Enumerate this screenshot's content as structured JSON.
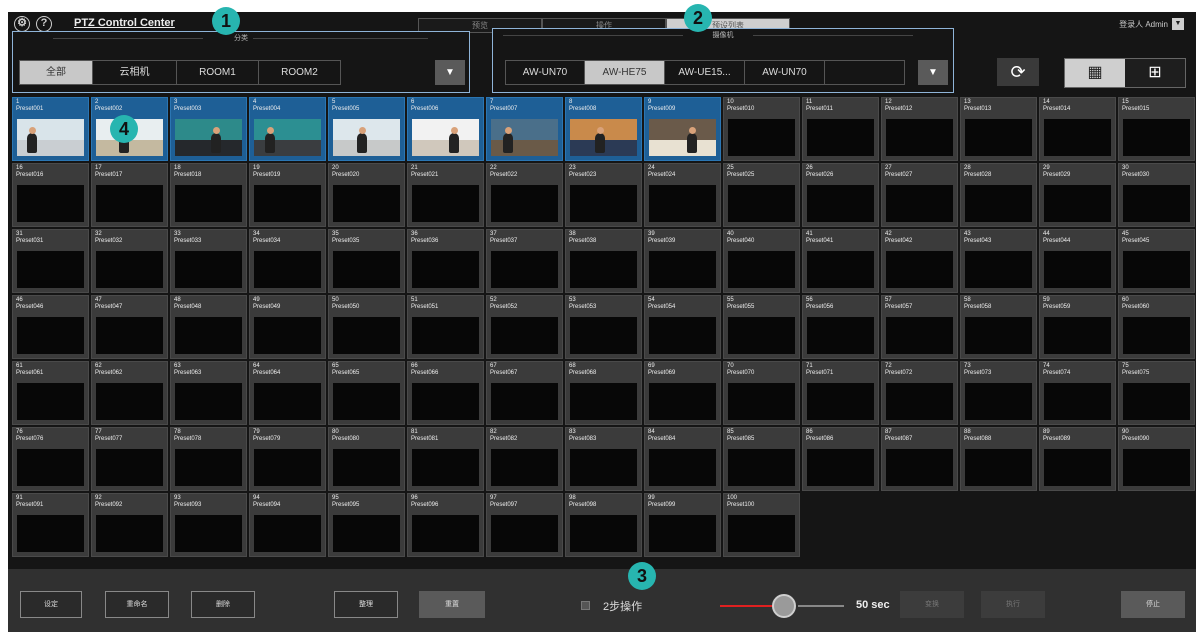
{
  "header": {
    "title": "PTZ Control Center",
    "mode_tabs": [
      "预览",
      "操作",
      "预设列表"
    ],
    "active_mode": 2,
    "login_label": "登录人 Admin"
  },
  "category_panel": {
    "label": "分类",
    "options": [
      "全部",
      "云相机",
      "ROOM1",
      "ROOM2"
    ],
    "selected": 0
  },
  "camera_panel": {
    "label": "摄像机",
    "options": [
      "AW-UN70",
      "AW-HE75",
      "AW-UE15...",
      "AW-UN70"
    ],
    "selected": 1
  },
  "view_toggle": {
    "selected": 0
  },
  "presets": [
    {
      "n": "1",
      "name": "Preset001",
      "thumb": true
    },
    {
      "n": "2",
      "name": "Preset002",
      "thumb": true
    },
    {
      "n": "3",
      "name": "Preset003",
      "thumb": true
    },
    {
      "n": "4",
      "name": "Preset004",
      "thumb": true
    },
    {
      "n": "5",
      "name": "Preset005",
      "thumb": true
    },
    {
      "n": "6",
      "name": "Preset006",
      "thumb": true
    },
    {
      "n": "7",
      "name": "Preset007",
      "thumb": true
    },
    {
      "n": "8",
      "name": "Preset008",
      "thumb": true
    },
    {
      "n": "9",
      "name": "Preset009",
      "thumb": true
    },
    {
      "n": "10",
      "name": "Preset010"
    },
    {
      "n": "11",
      "name": "Preset011"
    },
    {
      "n": "12",
      "name": "Preset012"
    },
    {
      "n": "13",
      "name": "Preset013"
    },
    {
      "n": "14",
      "name": "Preset014"
    },
    {
      "n": "15",
      "name": "Preset015"
    },
    {
      "n": "16",
      "name": "Preset016"
    },
    {
      "n": "17",
      "name": "Preset017"
    },
    {
      "n": "18",
      "name": "Preset018"
    },
    {
      "n": "19",
      "name": "Preset019"
    },
    {
      "n": "20",
      "name": "Preset020"
    },
    {
      "n": "21",
      "name": "Preset021"
    },
    {
      "n": "22",
      "name": "Preset022"
    },
    {
      "n": "23",
      "name": "Preset023"
    },
    {
      "n": "24",
      "name": "Preset024"
    },
    {
      "n": "25",
      "name": "Preset025"
    },
    {
      "n": "26",
      "name": "Preset026"
    },
    {
      "n": "27",
      "name": "Preset027"
    },
    {
      "n": "28",
      "name": "Preset028"
    },
    {
      "n": "29",
      "name": "Preset029"
    },
    {
      "n": "30",
      "name": "Preset030"
    },
    {
      "n": "31",
      "name": "Preset031"
    },
    {
      "n": "32",
      "name": "Preset032"
    },
    {
      "n": "33",
      "name": "Preset033"
    },
    {
      "n": "34",
      "name": "Preset034"
    },
    {
      "n": "35",
      "name": "Preset035"
    },
    {
      "n": "36",
      "name": "Preset036"
    },
    {
      "n": "37",
      "name": "Preset037"
    },
    {
      "n": "38",
      "name": "Preset038"
    },
    {
      "n": "39",
      "name": "Preset039"
    },
    {
      "n": "40",
      "name": "Preset040"
    },
    {
      "n": "41",
      "name": "Preset041"
    },
    {
      "n": "42",
      "name": "Preset042"
    },
    {
      "n": "43",
      "name": "Preset043"
    },
    {
      "n": "44",
      "name": "Preset044"
    },
    {
      "n": "45",
      "name": "Preset045"
    },
    {
      "n": "46",
      "name": "Preset046"
    },
    {
      "n": "47",
      "name": "Preset047"
    },
    {
      "n": "48",
      "name": "Preset048"
    },
    {
      "n": "49",
      "name": "Preset049"
    },
    {
      "n": "50",
      "name": "Preset050"
    },
    {
      "n": "51",
      "name": "Preset051"
    },
    {
      "n": "52",
      "name": "Preset052"
    },
    {
      "n": "53",
      "name": "Preset053"
    },
    {
      "n": "54",
      "name": "Preset054"
    },
    {
      "n": "55",
      "name": "Preset055"
    },
    {
      "n": "56",
      "name": "Preset056"
    },
    {
      "n": "57",
      "name": "Preset057"
    },
    {
      "n": "58",
      "name": "Preset058"
    },
    {
      "n": "59",
      "name": "Preset059"
    },
    {
      "n": "60",
      "name": "Preset060"
    },
    {
      "n": "61",
      "name": "Preset061"
    },
    {
      "n": "62",
      "name": "Preset062"
    },
    {
      "n": "63",
      "name": "Preset063"
    },
    {
      "n": "64",
      "name": "Preset064"
    },
    {
      "n": "65",
      "name": "Preset065"
    },
    {
      "n": "66",
      "name": "Preset066"
    },
    {
      "n": "67",
      "name": "Preset067"
    },
    {
      "n": "68",
      "name": "Preset068"
    },
    {
      "n": "69",
      "name": "Preset069"
    },
    {
      "n": "70",
      "name": "Preset070"
    },
    {
      "n": "71",
      "name": "Preset071"
    },
    {
      "n": "72",
      "name": "Preset072"
    },
    {
      "n": "73",
      "name": "Preset073"
    },
    {
      "n": "74",
      "name": "Preset074"
    },
    {
      "n": "75",
      "name": "Preset075"
    },
    {
      "n": "76",
      "name": "Preset076"
    },
    {
      "n": "77",
      "name": "Preset077"
    },
    {
      "n": "78",
      "name": "Preset078"
    },
    {
      "n": "79",
      "name": "Preset079"
    },
    {
      "n": "80",
      "name": "Preset080"
    },
    {
      "n": "81",
      "name": "Preset081"
    },
    {
      "n": "82",
      "name": "Preset082"
    },
    {
      "n": "83",
      "name": "Preset083"
    },
    {
      "n": "84",
      "name": "Preset084"
    },
    {
      "n": "85",
      "name": "Preset085"
    },
    {
      "n": "86",
      "name": "Preset086"
    },
    {
      "n": "87",
      "name": "Preset087"
    },
    {
      "n": "88",
      "name": "Preset088"
    },
    {
      "n": "89",
      "name": "Preset089"
    },
    {
      "n": "90",
      "name": "Preset090"
    },
    {
      "n": "91",
      "name": "Preset091"
    },
    {
      "n": "92",
      "name": "Preset092"
    },
    {
      "n": "93",
      "name": "Preset093"
    },
    {
      "n": "94",
      "name": "Preset094"
    },
    {
      "n": "95",
      "name": "Preset095"
    },
    {
      "n": "96",
      "name": "Preset096"
    },
    {
      "n": "97",
      "name": "Preset097"
    },
    {
      "n": "98",
      "name": "Preset098"
    },
    {
      "n": "99",
      "name": "Preset099"
    },
    {
      "n": "100",
      "name": "Preset100"
    }
  ],
  "toolbar": {
    "settings_label": "设定",
    "rename_label": "重命名",
    "delete_label": "删除",
    "organize_label": "整理",
    "reset_label": "重置",
    "two_step_label": "2步操作",
    "speed_value": "50 sec",
    "confirm_label": "变换",
    "execute_label": "执行",
    "stop_label": "停止"
  },
  "callouts": [
    "1",
    "2",
    "3",
    "4"
  ],
  "colors": {
    "background": "#151515",
    "selected_tile": "#1e5f96",
    "panel_border": "#8fb4d8",
    "callout": "#27b5b0",
    "slider_active": "#e02020"
  }
}
